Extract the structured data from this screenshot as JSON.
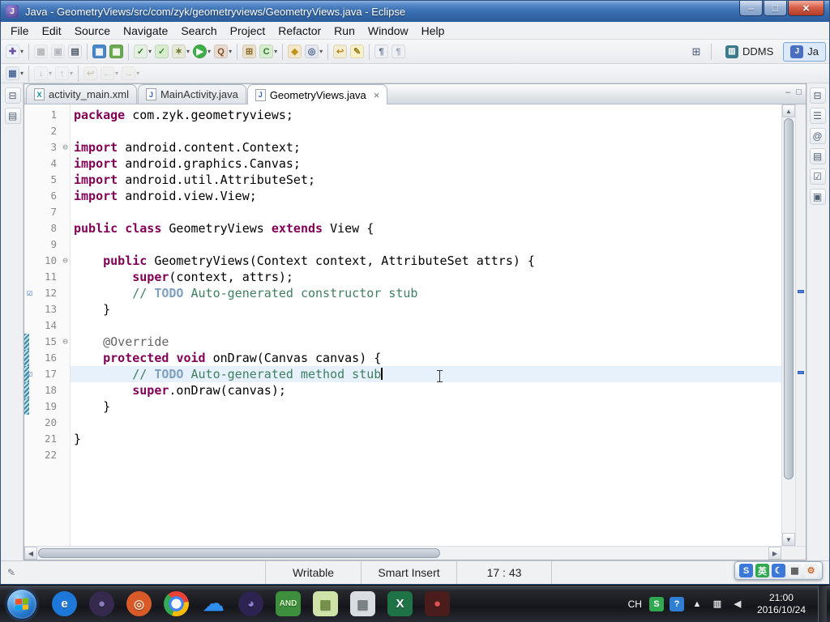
{
  "window": {
    "title": "Java - GeometryViews/src/com/zyk/geometryviews/GeometryViews.java - Eclipse",
    "app_icon_letter": "J",
    "controls": [
      {
        "name": "minimize-button",
        "glyph": "–"
      },
      {
        "name": "maximize-button",
        "glyph": "□"
      },
      {
        "name": "close-button",
        "glyph": "×"
      }
    ]
  },
  "menubar": {
    "items": [
      "File",
      "Edit",
      "Source",
      "Navigate",
      "Search",
      "Project",
      "Refactor",
      "Run",
      "Window",
      "Help"
    ]
  },
  "toolbar_row1": {
    "items": [
      {
        "name": "new-wizard-button",
        "glyph": "✚",
        "bg": "#eef2fa",
        "fg": "#6a4fa0",
        "dropdown": true
      },
      {
        "type": "sep"
      },
      {
        "name": "save-button",
        "glyph": "▦",
        "bg": "#e8eaf0",
        "fg": "#5a6a8a",
        "disabled": true
      },
      {
        "name": "save-all-button",
        "glyph": "▣",
        "bg": "#e8eaf0",
        "fg": "#5a6a8a",
        "disabled": true
      },
      {
        "name": "print-button",
        "glyph": "▤",
        "bg": "#eef0f4",
        "fg": "#4a5568"
      },
      {
        "type": "sep"
      },
      {
        "name": "android-sdk-manager-button",
        "glyph": "▦",
        "bg": "#4a86c8",
        "fg": "#ffffff"
      },
      {
        "name": "android-avd-manager-button",
        "glyph": "▦",
        "bg": "#6aaa50",
        "fg": "#ffffff"
      },
      {
        "type": "sep"
      },
      {
        "name": "run-history-button",
        "glyph": "✓",
        "bg": "#e4f0e0",
        "fg": "#2a7a2a",
        "dropdown": true
      },
      {
        "name": "junit-button",
        "glyph": "✓",
        "bg": "#d8ecd0",
        "fg": "#3a8a3a"
      },
      {
        "name": "debug-button",
        "glyph": "✶",
        "bg": "#e8e8d8",
        "fg": "#6a7a2a",
        "dropdown": true
      },
      {
        "name": "run-button",
        "glyph": "▶",
        "bg": "#3fae49",
        "fg": "#ffffff",
        "round": true,
        "dropdown": true
      },
      {
        "name": "coverage-button",
        "glyph": "Q",
        "bg": "#e8dcd0",
        "fg": "#8a4a2a",
        "dropdown": true
      },
      {
        "type": "sep"
      },
      {
        "name": "new-java-project-button",
        "glyph": "⊞",
        "bg": "#eadfc8",
        "fg": "#8a6a2a"
      },
      {
        "name": "new-class-button",
        "glyph": "C",
        "bg": "#d8ecd0",
        "fg": "#2a7a2a",
        "dropdown": true
      },
      {
        "type": "sep"
      },
      {
        "name": "open-type-button",
        "glyph": "◆",
        "bg": "#f4e8c8",
        "fg": "#c09020"
      },
      {
        "name": "search-button",
        "glyph": "◎",
        "bg": "#e4e8f0",
        "fg": "#4a5a8a",
        "dropdown": true
      },
      {
        "type": "sep"
      },
      {
        "name": "last-edit-location-button",
        "glyph": "↩",
        "bg": "#f4ecd0",
        "fg": "#b08a20"
      },
      {
        "name": "mark-occurrences-button",
        "glyph": "✎",
        "bg": "#f8f0c8",
        "fg": "#9a7a1a"
      },
      {
        "type": "sep"
      },
      {
        "name": "show-whitespace-button",
        "glyph": "¶",
        "bg": "#eef0f4",
        "fg": "#5a6a8a"
      },
      {
        "name": "block-selection-button",
        "glyph": "¶",
        "bg": "#eef0f4",
        "fg": "#9aa4b8"
      }
    ],
    "perspective_area": {
      "open_perspective_glyph": "⊞",
      "buttons": [
        {
          "name": "perspective-ddms",
          "label": "DDMS",
          "glyph": "▥",
          "glyph_bg": "#3a7a8a",
          "active": false
        },
        {
          "name": "perspective-java",
          "label": "Ja",
          "glyph": "J",
          "glyph_bg": "#4a6fc0",
          "active": true
        }
      ]
    }
  },
  "toolbar_row2": {
    "items": [
      {
        "name": "annotations-button",
        "glyph": "▦",
        "bg": "#e8ecf4",
        "fg": "#4a6a9a",
        "dropdown": true
      },
      {
        "type": "sep"
      },
      {
        "name": "next-annotation-button",
        "glyph": "↓",
        "bg": "#eef0f4",
        "fg": "#5a6a7a",
        "dropdown": true,
        "disabled": true
      },
      {
        "name": "previous-annotation-button",
        "glyph": "↑",
        "bg": "#eef0f4",
        "fg": "#5a6a7a",
        "dropdown": true,
        "disabled": true
      },
      {
        "type": "sep"
      },
      {
        "name": "last-edit-button",
        "glyph": "↩",
        "bg": "#f4ecd0",
        "fg": "#b08a20",
        "disabled": true
      },
      {
        "name": "back-button",
        "glyph": "←",
        "bg": "#f0ecd8",
        "fg": "#9a8a4a",
        "dropdown": true,
        "disabled": true
      },
      {
        "name": "forward-button",
        "glyph": "→",
        "bg": "#f0ecd8",
        "fg": "#9a8a4a",
        "dropdown": true,
        "disabled": true
      }
    ]
  },
  "left_strip": {
    "icons": [
      {
        "name": "restore-explorer-icon",
        "glyph": "⊟"
      },
      {
        "name": "package-explorer-icon",
        "glyph": "▤"
      }
    ]
  },
  "right_strip": {
    "icons": [
      {
        "name": "restore-outline-icon",
        "glyph": "⊟"
      },
      {
        "name": "outline-icon",
        "glyph": "☰"
      },
      {
        "name": "javadoc-icon",
        "glyph": "@"
      },
      {
        "name": "declaration-icon",
        "glyph": "▤"
      },
      {
        "name": "tasks-icon",
        "glyph": "☑"
      },
      {
        "name": "console-icon",
        "glyph": "▣"
      }
    ]
  },
  "editor_tabs": {
    "tabs": [
      {
        "name": "tab-activity-main-xml",
        "label": "activity_main.xml",
        "icon": "X",
        "icon_color": "#0a8a9a",
        "active": false
      },
      {
        "name": "tab-mainactivity-java",
        "label": "MainActivity.java",
        "icon": "J",
        "icon_color": "#3a5fc0",
        "active": false
      },
      {
        "name": "tab-geometryviews-java",
        "label": "GeometryViews.java",
        "icon": "J",
        "icon_color": "#3a5fc0",
        "active": true,
        "close_glyph": "×"
      }
    ],
    "minimize_glyph": "–",
    "maximize_glyph": "□"
  },
  "editor": {
    "colors": {
      "keyword": "#7f0055",
      "comment": "#3f7f5f",
      "task_tag": "#7f9fbf",
      "annotation": "#646464",
      "plain": "#000000",
      "current_line": "#e6f1fc",
      "line_number": "#8a8a8a"
    },
    "lines": [
      {
        "n": 1,
        "segs": [
          [
            "k",
            "package"
          ],
          [
            "p",
            " com.zyk.geometryviews;"
          ]
        ]
      },
      {
        "n": 2,
        "segs": []
      },
      {
        "n": 3,
        "fold": true,
        "segs": [
          [
            "k",
            "import"
          ],
          [
            "p",
            " android.content.Context;"
          ]
        ]
      },
      {
        "n": 4,
        "segs": [
          [
            "k",
            "import"
          ],
          [
            "p",
            " android.graphics.Canvas;"
          ]
        ]
      },
      {
        "n": 5,
        "segs": [
          [
            "k",
            "import"
          ],
          [
            "p",
            " android.util.AttributeSet;"
          ]
        ]
      },
      {
        "n": 6,
        "segs": [
          [
            "k",
            "import"
          ],
          [
            "p",
            " android.view.View;"
          ]
        ]
      },
      {
        "n": 7,
        "segs": []
      },
      {
        "n": 8,
        "segs": [
          [
            "k",
            "public"
          ],
          [
            "p",
            " "
          ],
          [
            "k",
            "class"
          ],
          [
            "p",
            " GeometryViews "
          ],
          [
            "k",
            "extends"
          ],
          [
            "p",
            " View {"
          ]
        ]
      },
      {
        "n": 9,
        "segs": []
      },
      {
        "n": 10,
        "fold": true,
        "segs": [
          [
            "p",
            "    "
          ],
          [
            "k",
            "public"
          ],
          [
            "p",
            " GeometryViews(Context context, AttributeSet attrs) {"
          ]
        ]
      },
      {
        "n": 11,
        "segs": [
          [
            "p",
            "        "
          ],
          [
            "k",
            "super"
          ],
          [
            "p",
            "(context, attrs);"
          ]
        ]
      },
      {
        "n": 12,
        "task": true,
        "segs": [
          [
            "p",
            "        "
          ],
          [
            "c",
            "// "
          ],
          [
            "t",
            "TODO"
          ],
          [
            "c",
            " Auto-generated constructor stub"
          ]
        ]
      },
      {
        "n": 13,
        "segs": [
          [
            "p",
            "    }"
          ]
        ]
      },
      {
        "n": 14,
        "segs": []
      },
      {
        "n": 15,
        "fold": true,
        "changed": true,
        "segs": [
          [
            "p",
            "    "
          ],
          [
            "a",
            "@Override"
          ]
        ]
      },
      {
        "n": 16,
        "changed": true,
        "segs": [
          [
            "p",
            "    "
          ],
          [
            "k",
            "protected"
          ],
          [
            "p",
            " "
          ],
          [
            "k",
            "void"
          ],
          [
            "p",
            " onDraw(Canvas canvas) {"
          ]
        ]
      },
      {
        "n": 17,
        "task": true,
        "changed": true,
        "current": true,
        "caret": true,
        "segs": [
          [
            "p",
            "        "
          ],
          [
            "c",
            "// "
          ],
          [
            "t",
            "TODO"
          ],
          [
            "c",
            " Auto-generated method stub"
          ]
        ]
      },
      {
        "n": 18,
        "changed": true,
        "segs": [
          [
            "p",
            "        "
          ],
          [
            "k",
            "super"
          ],
          [
            "p",
            ".onDraw(canvas);"
          ]
        ]
      },
      {
        "n": 19,
        "changed": true,
        "segs": [
          [
            "p",
            "    }"
          ]
        ]
      },
      {
        "n": 20,
        "segs": []
      },
      {
        "n": 21,
        "segs": [
          [
            "p",
            "}"
          ]
        ]
      },
      {
        "n": 22,
        "segs": []
      }
    ],
    "fold_glyph": "⊖",
    "task_marker_glyph": "☑",
    "overview_marks": [
      12,
      17
    ]
  },
  "statusbar": {
    "left_icon": "✎",
    "writable": "Writable",
    "input_mode": "Smart Insert",
    "caret_position": "17 : 43"
  },
  "taskbar": {
    "flag_colors": [
      "#f25022",
      "#7fba00",
      "#00a4ef",
      "#ffb900"
    ],
    "apps": [
      {
        "name": "internet-explorer-icon",
        "glyph": "e",
        "bg": "#1e78d7",
        "fg": "#ffffff",
        "shape": "circle"
      },
      {
        "name": "dark-browser-icon",
        "glyph": "●",
        "bg": "#352a4e",
        "fg": "#8a7fb8",
        "shape": "circle"
      },
      {
        "name": "orange-ring-app-icon",
        "glyph": "◎",
        "bg": "#d85a28",
        "fg": "#ffd9c2",
        "shape": "circle"
      },
      {
        "name": "chrome-icon",
        "glyph": "",
        "bg": "",
        "fg": "",
        "shape": "chrome"
      },
      {
        "name": "cloud-app-icon",
        "glyph": "☁",
        "bg": "transparent",
        "fg": "#2e8ded",
        "shape": "none",
        "big": true
      },
      {
        "name": "purple-app-icon",
        "glyph": "◕",
        "bg": "#2c2350",
        "fg": "#8f7fd0",
        "shape": "circle"
      },
      {
        "name": "android-emulator-icon",
        "glyph": "AND",
        "bg": "#3d8f3d",
        "fg": "#d8f0c8",
        "shape": "rounded",
        "small": true
      },
      {
        "name": "notepad-green-icon",
        "glyph": "▤",
        "bg": "#cfe3a8",
        "fg": "#6a8a3a",
        "shape": "rounded"
      },
      {
        "name": "notepad-gray-icon",
        "glyph": "▤",
        "bg": "#d8dde2",
        "fg": "#707880",
        "shape": "rounded"
      },
      {
        "name": "excel-icon",
        "glyph": "X",
        "bg": "#1f7246",
        "fg": "#ffffff",
        "shape": "rounded"
      },
      {
        "name": "screen-recorder-icon",
        "glyph": "●",
        "bg": "#4a1c1c",
        "fg": "#e05050",
        "shape": "rounded"
      }
    ],
    "tray": {
      "lang_indicator": "CH",
      "icons": [
        {
          "name": "ime-tray-icon",
          "glyph": "S",
          "bg": "#2fa84f",
          "fg": "#ffffff"
        },
        {
          "name": "help-tray-icon",
          "glyph": "?",
          "bg": "#2f7fd4",
          "fg": "#ffffff"
        },
        {
          "name": "hidden-icons-arrow",
          "glyph": "▲",
          "bg": "transparent",
          "fg": "#e8e8e8"
        },
        {
          "name": "network-tray-icon",
          "glyph": "▥",
          "bg": "transparent",
          "fg": "#dcdcdc"
        },
        {
          "name": "volume-tray-icon",
          "glyph": "◀",
          "bg": "transparent",
          "fg": "#dcdcdc"
        }
      ],
      "clock": {
        "time": "21:00",
        "date": "2016/10/24"
      }
    }
  },
  "ime_bar": {
    "icons": [
      {
        "name": "ime-logo-icon",
        "glyph": "S",
        "bg": "#3b78d8",
        "fg": "#ffffff"
      },
      {
        "name": "ime-language-icon",
        "glyph": "英",
        "bg": "#2fa84f",
        "fg": "#ffffff"
      },
      {
        "name": "ime-moon-icon",
        "glyph": "☾",
        "bg": "#3b78d8",
        "fg": "#ffffff"
      },
      {
        "name": "ime-keyboard-icon",
        "glyph": "▦",
        "bg": "#eef0f2",
        "fg": "#555555"
      },
      {
        "name": "ime-toolbox-icon",
        "glyph": "⚙",
        "bg": "#eef0f2",
        "fg": "#d06a2a"
      }
    ]
  }
}
